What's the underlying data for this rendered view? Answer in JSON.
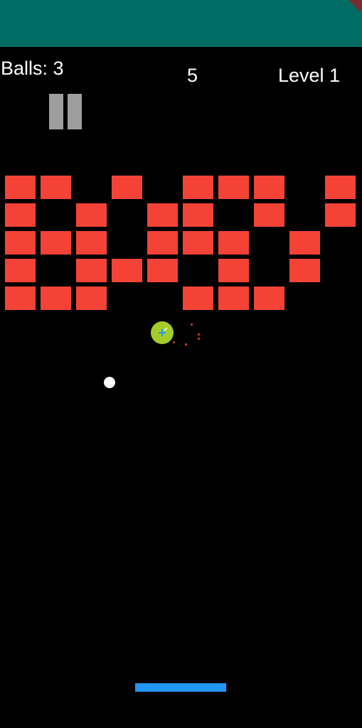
{
  "hud": {
    "balls_label": "Balls: 3",
    "score": "5",
    "level_label": "Level 1"
  },
  "colors": {
    "app_bar": "#006c64",
    "background": "#000000",
    "brick": "#f44336",
    "paddle": "#2196f3",
    "ball": "#ffffff",
    "powerup": "#a4cc2a",
    "pause_icon": "#9e9e9e"
  },
  "controls": {
    "pause_icon": "pause-icon"
  },
  "bricks": {
    "columns": 10,
    "rows": 5,
    "grid": [
      [
        1,
        1,
        0,
        1,
        0,
        1,
        1,
        1,
        0,
        1
      ],
      [
        1,
        0,
        1,
        0,
        1,
        1,
        0,
        1,
        0,
        1
      ],
      [
        1,
        1,
        1,
        0,
        1,
        1,
        1,
        0,
        1,
        0
      ],
      [
        1,
        0,
        1,
        1,
        1,
        0,
        1,
        0,
        1,
        0
      ],
      [
        1,
        1,
        1,
        0,
        0,
        1,
        1,
        1,
        0,
        0
      ]
    ]
  },
  "powerup": {
    "icon": "plus-icon"
  }
}
